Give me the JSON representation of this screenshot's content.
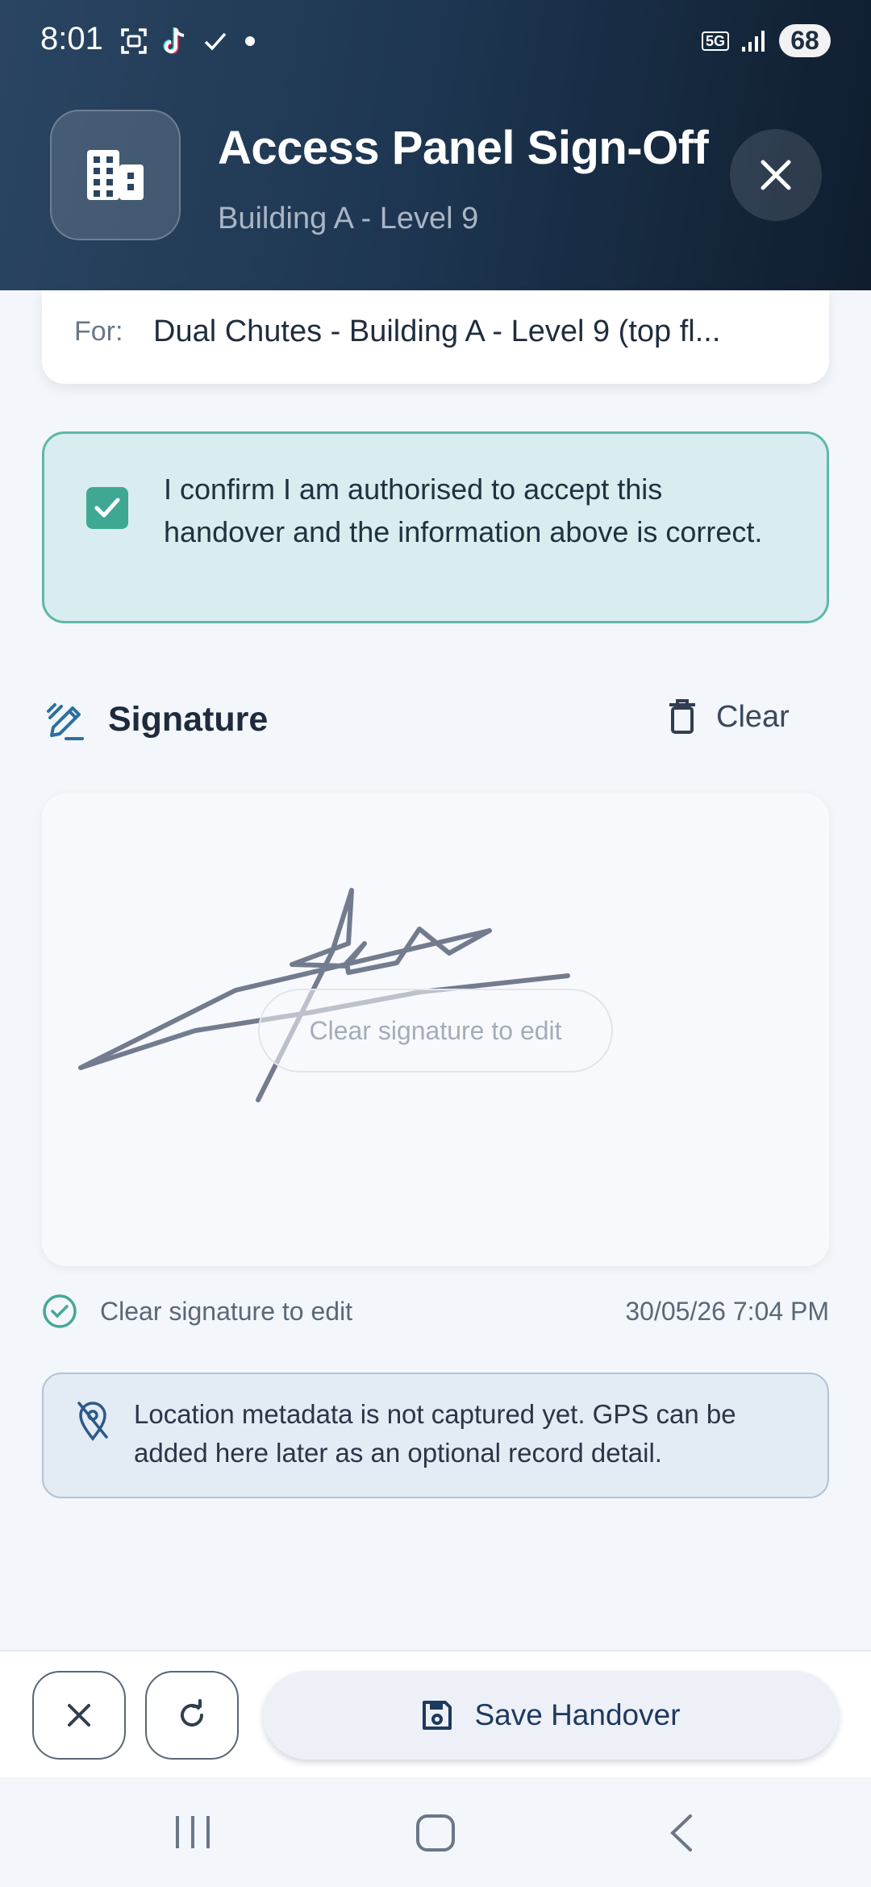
{
  "status_bar": {
    "time": "8:01",
    "network": "5G",
    "battery": "68"
  },
  "header": {
    "title": "Access Panel Sign-Off",
    "subtitle": "Building A - Level 9",
    "icon": "building-icon",
    "close_icon": "close-icon"
  },
  "for_card": {
    "label": "For:",
    "value": "Dual Chutes - Building A - Level 9 (top fl..."
  },
  "confirmation": {
    "checked": true,
    "text": "I confirm I am authorised to accept this handover and the information above is correct."
  },
  "signature": {
    "title": "Signature",
    "clear_label": "Clear",
    "overlay_text": "Clear signature to edit",
    "status_text": "Clear signature to edit",
    "timestamp": "30/05/26  7:04 PM"
  },
  "location_note": {
    "text": "Location metadata is not captured yet. GPS can be added here later as an optional record detail."
  },
  "actions": {
    "save_label": "Save Handover"
  },
  "colors": {
    "header_dark": "#1d3550",
    "accent_teal": "#3ea893",
    "confirm_bg": "#d9ecef",
    "save_text": "#1d3a5e"
  }
}
